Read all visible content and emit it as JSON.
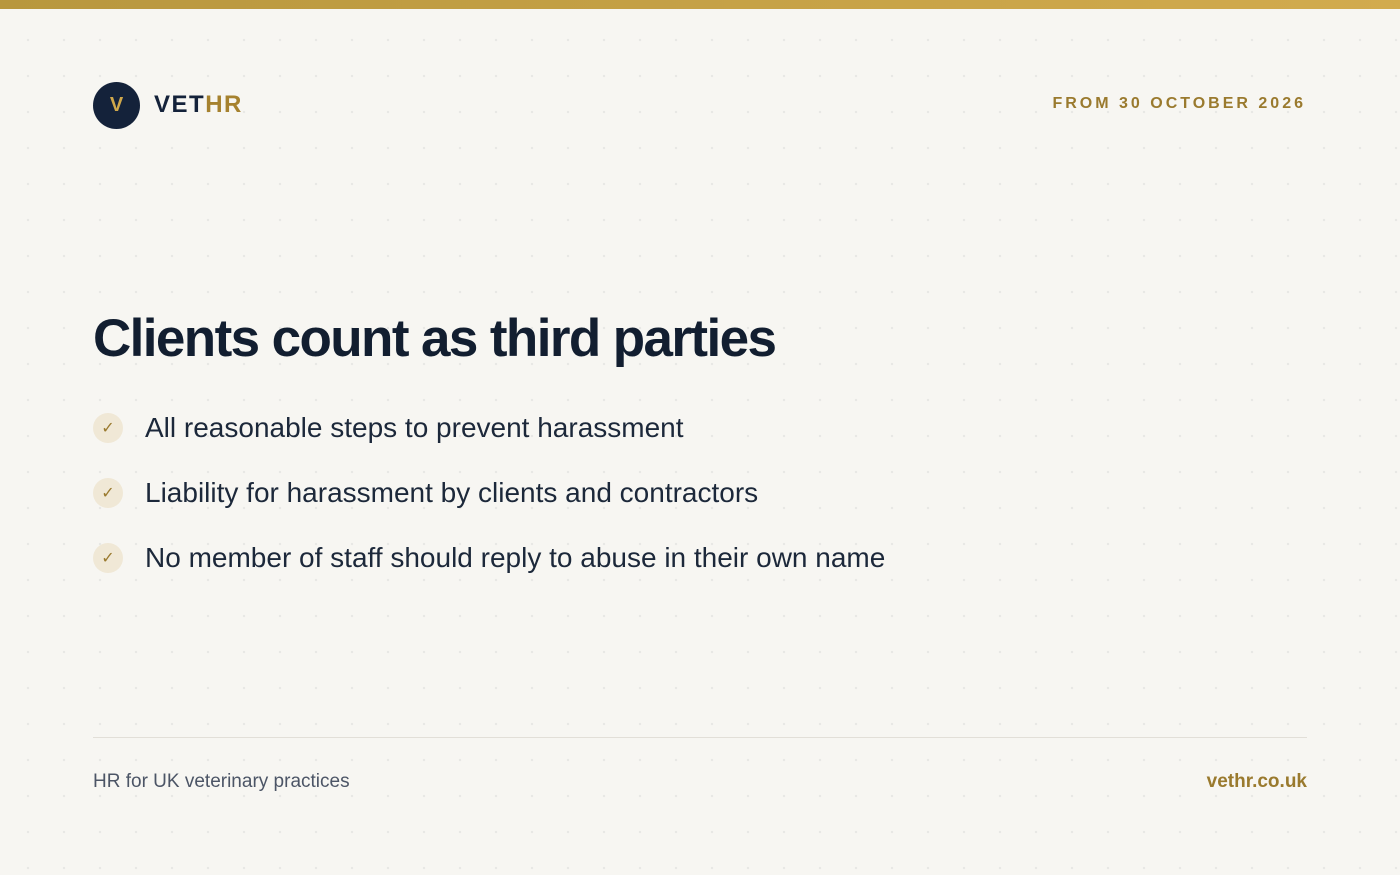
{
  "brand": {
    "logo_letter": "V",
    "name_primary": "VET",
    "name_accent": "HR"
  },
  "header": {
    "date_label": "FROM 30 OCTOBER 2026"
  },
  "main": {
    "title": "Clients count as third parties",
    "bullets": [
      {
        "icon": "check-icon",
        "text": "All reasonable steps to prevent harassment"
      },
      {
        "icon": "check-icon",
        "text": "Liability for harassment by clients and contractors"
      },
      {
        "icon": "check-icon",
        "text": "No member of staff should reply to abuse in their own name"
      }
    ]
  },
  "footer": {
    "tagline": "HR for UK veterinary practices",
    "website": "vethr.co.uk"
  },
  "colors": {
    "navy": "#14223a",
    "gold": "#9a7a2e",
    "background": "#f7f6f2"
  }
}
